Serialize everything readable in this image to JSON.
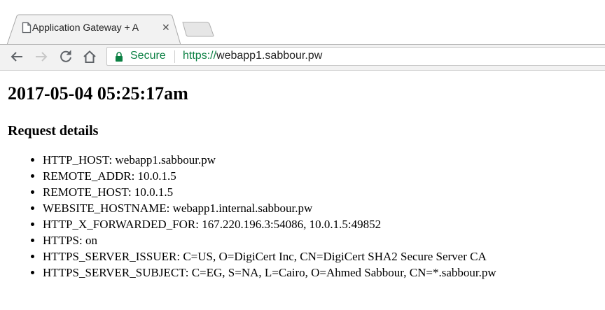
{
  "browser": {
    "tab": {
      "title": "Application Gateway + A",
      "favicon": "page-icon",
      "close": "close-icon"
    },
    "toolbar": {
      "back": "back-arrow-icon",
      "forward": "forward-arrow-icon",
      "reload": "reload-icon",
      "home": "home-icon"
    },
    "omnibox": {
      "security_label": "Secure",
      "scheme": "https://",
      "host": "webapp1.sabbour.pw",
      "secure_color": "#0b8043"
    }
  },
  "page": {
    "timestamp": "2017-05-04 05:25:17am",
    "section_title": "Request details",
    "details": [
      {
        "key": "HTTP_HOST",
        "value": "webapp1.sabbour.pw"
      },
      {
        "key": "REMOTE_ADDR",
        "value": "10.0.1.5"
      },
      {
        "key": "REMOTE_HOST",
        "value": "10.0.1.5"
      },
      {
        "key": "WEBSITE_HOSTNAME",
        "value": "webapp1.internal.sabbour.pw"
      },
      {
        "key": "HTTP_X_FORWARDED_FOR",
        "value": "167.220.196.3:54086, 10.0.1.5:49852"
      },
      {
        "key": "HTTPS",
        "value": "on"
      },
      {
        "key": "HTTPS_SERVER_ISSUER",
        "value": "C=US, O=DigiCert Inc, CN=DigiCert SHA2 Secure Server CA"
      },
      {
        "key": "HTTPS_SERVER_SUBJECT",
        "value": "C=EG, S=NA, L=Cairo, O=Ahmed Sabbour, CN=*.sabbour.pw"
      }
    ]
  }
}
